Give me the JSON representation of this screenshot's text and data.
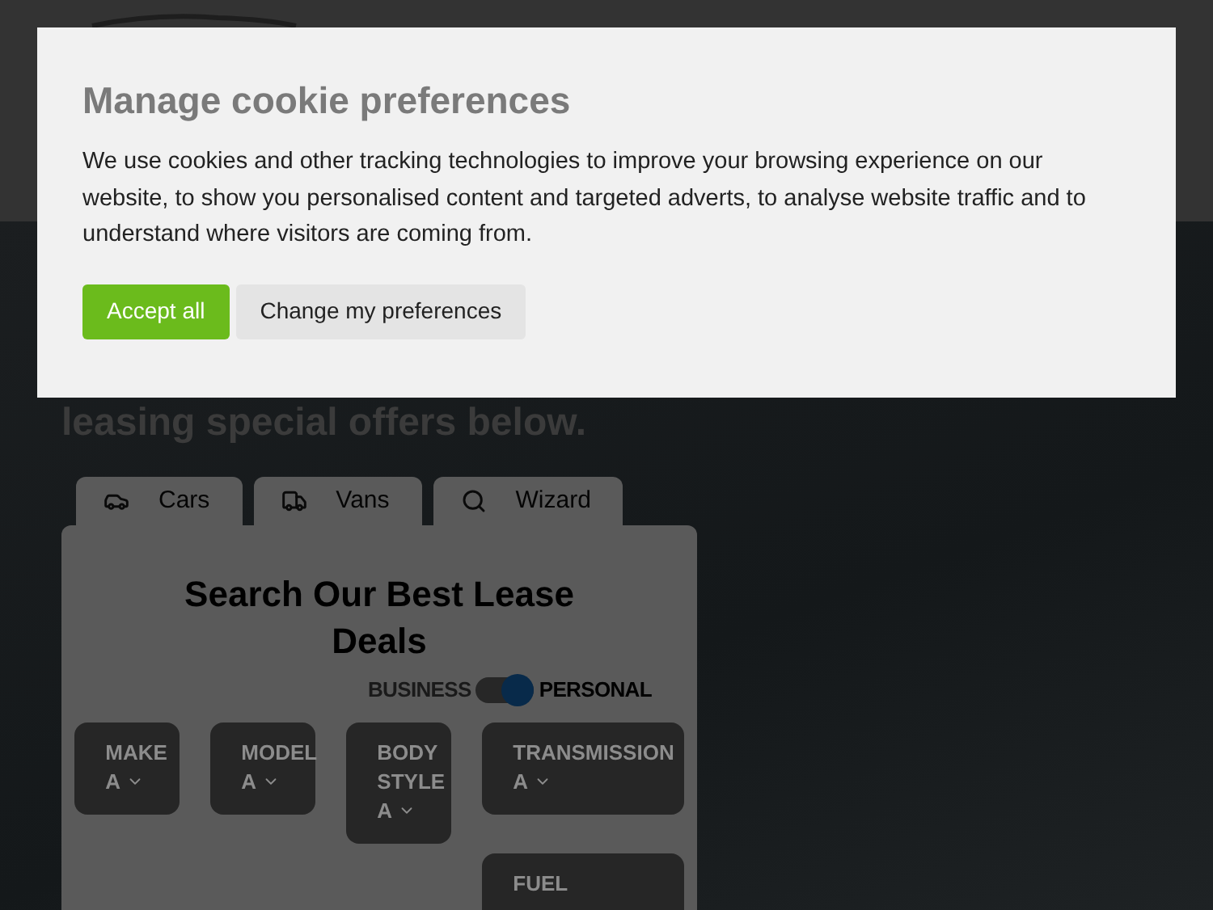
{
  "hero": {
    "heading": "leasing special offers below."
  },
  "tabs": [
    {
      "label": "Cars",
      "selected": false
    },
    {
      "label": "Vans",
      "selected": false
    },
    {
      "label": "Wizard",
      "selected": false
    }
  ],
  "search_card": {
    "title": "Search Our Best Lease Deals",
    "toggle": {
      "left_label": "BUSINESS",
      "right_label": "PERSONAL",
      "on": true
    },
    "filters": [
      {
        "label": "MAKE",
        "value": "A"
      },
      {
        "label": "MODEL",
        "value": "A"
      },
      {
        "label": "BODY STYLE",
        "value": "A"
      },
      {
        "label": "TRANSMISSION",
        "value": "A"
      },
      {
        "label": "FUEL"
      }
    ]
  },
  "cookie_dialog": {
    "title": "Manage cookie preferences",
    "message": "We use cookies and other tracking technologies to improve your browsing experience on our website, to show you personalised content and targeted adverts, to analyse website traffic and to understand where visitors are coming from.",
    "buttons": [
      {
        "label": "Accept all",
        "kind": "primary"
      },
      {
        "label": "Change my preferences",
        "kind": "secondary"
      }
    ]
  }
}
